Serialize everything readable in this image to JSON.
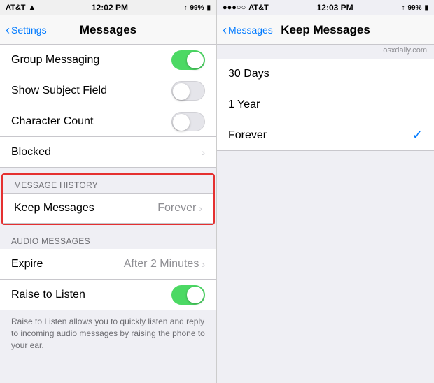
{
  "left": {
    "status_bar": {
      "carrier": "AT&T",
      "signal": "●●●○○",
      "wifi": "▲",
      "time": "12:02 PM",
      "gps": "↑",
      "battery_pct": "99%"
    },
    "nav": {
      "back_label": "Settings",
      "title": "Messages"
    },
    "rows": [
      {
        "label": "Group Messaging",
        "type": "toggle",
        "value": "on"
      },
      {
        "label": "Show Subject Field",
        "type": "toggle",
        "value": "off"
      },
      {
        "label": "Character Count",
        "type": "toggle",
        "value": "off"
      },
      {
        "label": "Blocked",
        "type": "chevron"
      }
    ],
    "message_history": {
      "header": "MESSAGE HISTORY",
      "keep_label": "Keep Messages",
      "keep_value": "Forever"
    },
    "audio_messages": {
      "header": "AUDIO MESSAGES",
      "expire_label": "Expire",
      "expire_value": "After 2 Minutes",
      "raise_label": "Raise to Listen",
      "raise_value": "on"
    },
    "description": "Raise to Listen allows you to quickly listen and reply to incoming audio messages by raising the phone to your ear."
  },
  "right": {
    "status_bar": {
      "dots": "●●●○○",
      "carrier": "AT&T",
      "time": "12:03 PM",
      "gps": "↑",
      "battery_pct": "99%"
    },
    "nav": {
      "back_label": "Messages",
      "title": "Keep Messages"
    },
    "watermark": "osxdaily.com",
    "options": [
      {
        "label": "30 Days",
        "selected": false
      },
      {
        "label": "1 Year",
        "selected": false
      },
      {
        "label": "Forever",
        "selected": true
      }
    ]
  }
}
